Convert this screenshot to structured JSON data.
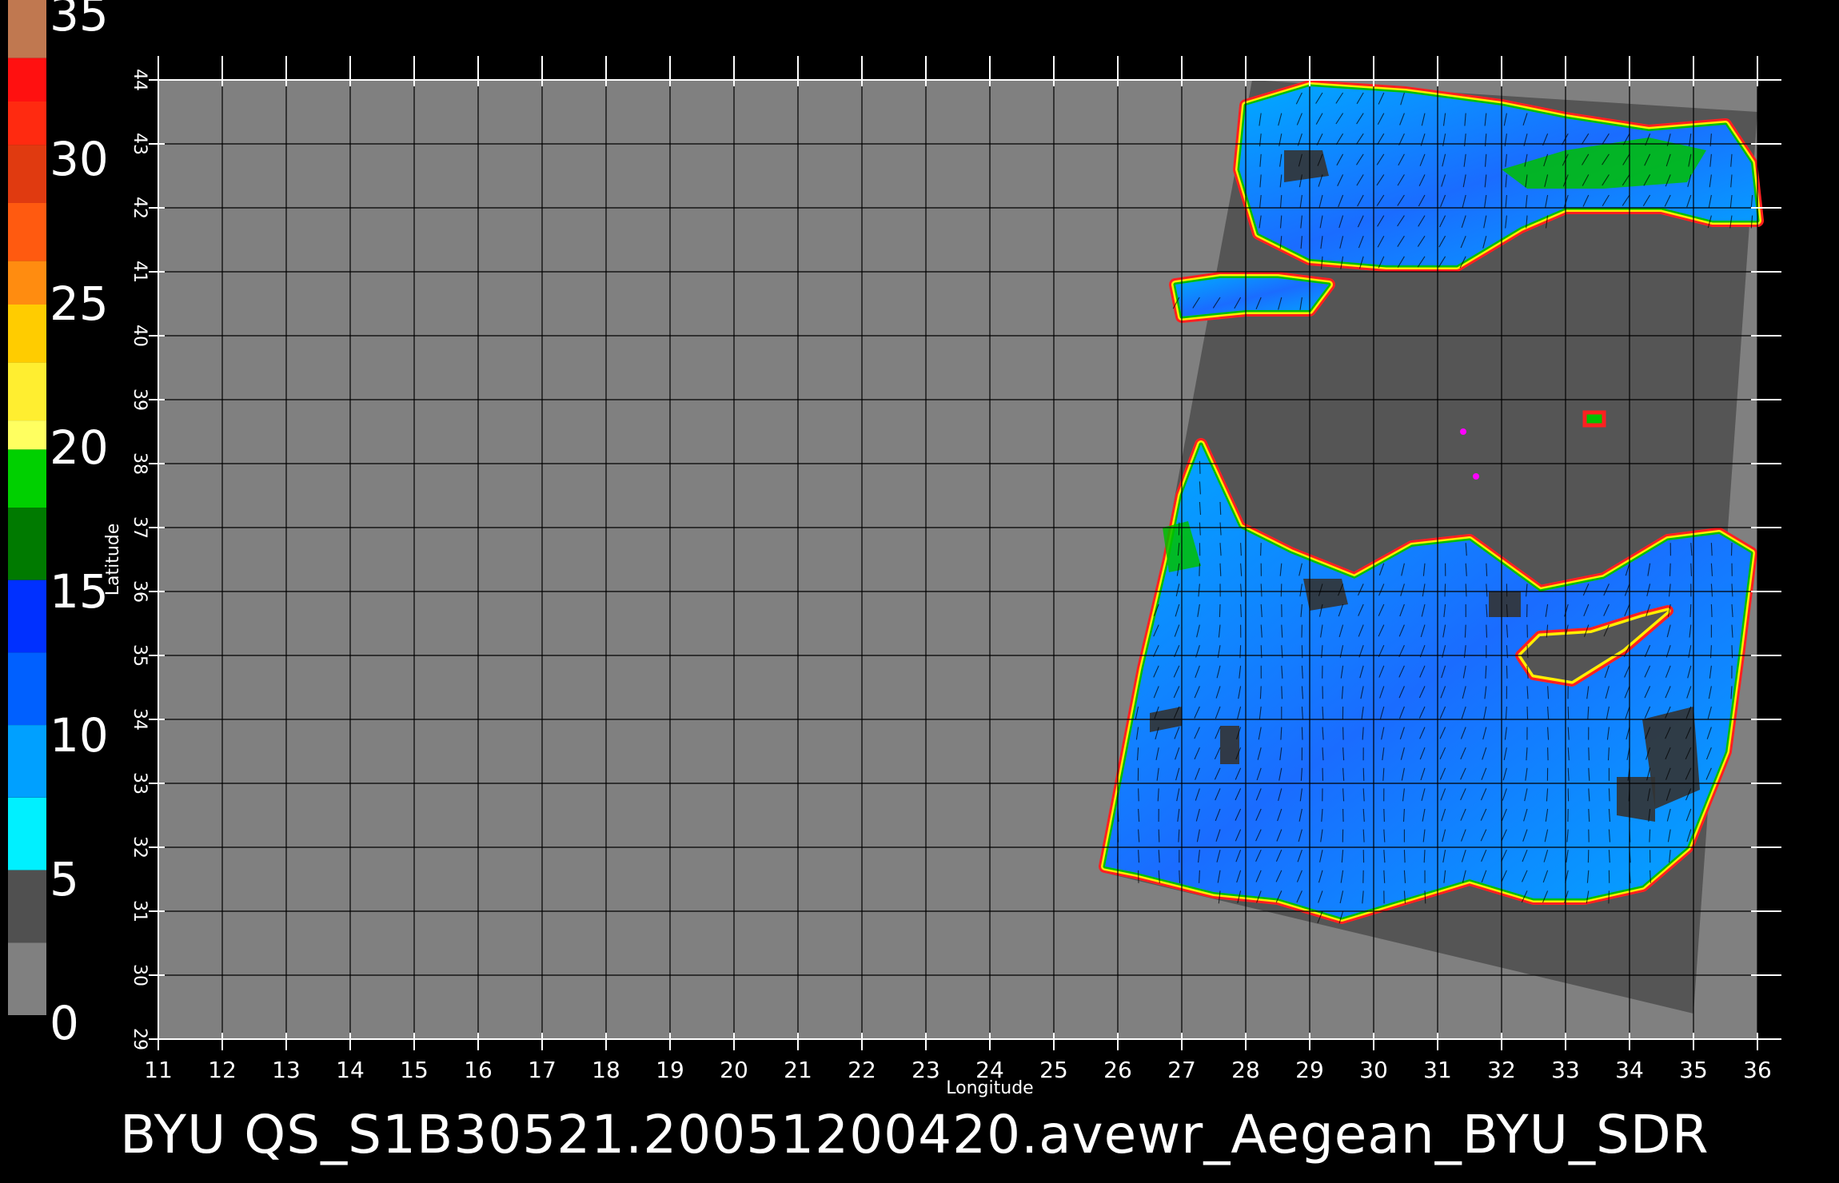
{
  "legend": {
    "tick_labels": [
      "35",
      "30",
      "25",
      "20",
      "15",
      "10",
      "5",
      "0"
    ],
    "color_stops": [
      {
        "from": 35,
        "to": 33,
        "color": "#c07850"
      },
      {
        "from": 33,
        "to": 31.5,
        "color": "#ff1010"
      },
      {
        "from": 31.5,
        "to": 30,
        "color": "#ff2a10"
      },
      {
        "from": 30,
        "to": 28,
        "color": "#e03a10"
      },
      {
        "from": 28,
        "to": 26,
        "color": "#ff5a10"
      },
      {
        "from": 26,
        "to": 24.5,
        "color": "#ff8c10"
      },
      {
        "from": 24.5,
        "to": 22.5,
        "color": "#ffcc00"
      },
      {
        "from": 22.5,
        "to": 20.5,
        "color": "#ffee30"
      },
      {
        "from": 20.5,
        "to": 19.5,
        "color": "#ffff60"
      },
      {
        "from": 19.5,
        "to": 17.5,
        "color": "#00d000"
      },
      {
        "from": 17.5,
        "to": 15,
        "color": "#007a00"
      },
      {
        "from": 15,
        "to": 12.5,
        "color": "#0030ff"
      },
      {
        "from": 12.5,
        "to": 10,
        "color": "#0060ff"
      },
      {
        "from": 10,
        "to": 7.5,
        "color": "#00a0ff"
      },
      {
        "from": 7.5,
        "to": 5,
        "color": "#00f0ff"
      },
      {
        "from": 5,
        "to": 2.5,
        "color": "#505050"
      },
      {
        "from": 2.5,
        "to": 0,
        "color": "#808080"
      }
    ]
  },
  "map": {
    "lon_range": [
      11,
      36
    ],
    "lat_range": [
      29,
      44
    ],
    "x_ticks": [
      "11",
      "12",
      "13",
      "14",
      "15",
      "16",
      "17",
      "18",
      "19",
      "20",
      "21",
      "22",
      "23",
      "24",
      "25",
      "26",
      "27",
      "28",
      "29",
      "30",
      "31",
      "32",
      "33",
      "34",
      "35",
      "36"
    ],
    "y_ticks": [
      "29",
      "30",
      "31",
      "32",
      "33",
      "34",
      "35",
      "36",
      "37",
      "38",
      "39",
      "40",
      "41",
      "42",
      "43",
      "44"
    ],
    "x_axis_label": "Longitude",
    "y_axis_label": "Latitude",
    "colors": {
      "background": "#000000",
      "no_data": "#808080",
      "swath_land": "#555555",
      "grid": "#000000",
      "axis": "#ffffff",
      "wind_low": "#1a6cff",
      "wind_mid": "#00aaff",
      "coast_green": "#00c000",
      "coast_yellow": "#ffee00",
      "coast_red": "#ff2020",
      "coast_magenta": "#ff00ff",
      "land_patch": "#333333"
    },
    "swath_corners": [
      [
        28.1,
        44.0
      ],
      [
        36.0,
        43.5
      ],
      [
        35.0,
        29.4
      ],
      [
        25.8,
        31.6
      ]
    ],
    "sea_regions": {
      "black_sea": [
        [
          28.0,
          43.6
        ],
        [
          29.0,
          43.9
        ],
        [
          30.5,
          43.8
        ],
        [
          32.0,
          43.6
        ],
        [
          33.0,
          43.4
        ],
        [
          34.3,
          43.2
        ],
        [
          35.5,
          43.3
        ],
        [
          35.9,
          42.7
        ],
        [
          36.0,
          41.8
        ],
        [
          35.3,
          41.8
        ],
        [
          34.5,
          42.0
        ],
        [
          33.0,
          42.0
        ],
        [
          32.3,
          41.7
        ],
        [
          31.3,
          41.1
        ],
        [
          30.2,
          41.1
        ],
        [
          29.0,
          41.2
        ],
        [
          28.2,
          41.6
        ],
        [
          27.9,
          42.6
        ]
      ],
      "marmara": [
        [
          26.9,
          40.8
        ],
        [
          27.6,
          40.9
        ],
        [
          28.5,
          40.9
        ],
        [
          29.3,
          40.8
        ],
        [
          29.0,
          40.4
        ],
        [
          28.0,
          40.4
        ],
        [
          27.0,
          40.3
        ]
      ],
      "mediterranean": [
        [
          27.3,
          38.3
        ],
        [
          27.9,
          37.0
        ],
        [
          28.7,
          36.6
        ],
        [
          29.7,
          36.2
        ],
        [
          30.6,
          36.7
        ],
        [
          31.5,
          36.8
        ],
        [
          32.6,
          36.0
        ],
        [
          33.6,
          36.2
        ],
        [
          34.6,
          36.8
        ],
        [
          35.4,
          36.9
        ],
        [
          35.9,
          36.6
        ],
        [
          35.7,
          35.0
        ],
        [
          35.5,
          33.5
        ],
        [
          34.9,
          32.0
        ],
        [
          34.2,
          31.4
        ],
        [
          33.3,
          31.2
        ],
        [
          32.5,
          31.2
        ],
        [
          31.5,
          31.5
        ],
        [
          30.5,
          31.2
        ],
        [
          29.5,
          30.9
        ],
        [
          28.5,
          31.2
        ],
        [
          27.5,
          31.3
        ],
        [
          26.3,
          31.6
        ],
        [
          25.8,
          31.7
        ],
        [
          26.4,
          34.8
        ],
        [
          26.8,
          36.5
        ],
        [
          27.0,
          37.5
        ]
      ]
    },
    "cyprus": [
      [
        32.3,
        35.0
      ],
      [
        32.6,
        35.3
      ],
      [
        33.4,
        35.35
      ],
      [
        34.2,
        35.6
      ],
      [
        34.6,
        35.7
      ],
      [
        33.9,
        35.1
      ],
      [
        33.1,
        34.6
      ],
      [
        32.5,
        34.7
      ]
    ],
    "lakes": [
      [
        33.3,
        38.8
      ],
      [
        33.6,
        38.8
      ],
      [
        33.6,
        38.6
      ],
      [
        33.3,
        38.6
      ]
    ],
    "green_patches": [
      [
        [
          32.0,
          42.6
        ],
        [
          33.0,
          42.9
        ],
        [
          34.3,
          43.1
        ],
        [
          35.2,
          42.9
        ],
        [
          34.9,
          42.4
        ],
        [
          33.6,
          42.3
        ],
        [
          32.4,
          42.3
        ]
      ],
      [
        [
          26.7,
          37.0
        ],
        [
          27.1,
          37.1
        ],
        [
          27.3,
          36.4
        ],
        [
          26.8,
          36.3
        ]
      ]
    ],
    "dark_patches": [
      [
        [
          28.6,
          42.9
        ],
        [
          29.2,
          42.9
        ],
        [
          29.3,
          42.5
        ],
        [
          28.6,
          42.4
        ]
      ],
      [
        [
          28.9,
          36.2
        ],
        [
          29.5,
          36.2
        ],
        [
          29.6,
          35.8
        ],
        [
          29.0,
          35.7
        ]
      ],
      [
        [
          26.5,
          34.1
        ],
        [
          27.0,
          34.2
        ],
        [
          27.0,
          33.9
        ],
        [
          26.5,
          33.8
        ]
      ],
      [
        [
          27.6,
          33.9
        ],
        [
          27.9,
          33.9
        ],
        [
          27.9,
          33.3
        ],
        [
          27.6,
          33.3
        ]
      ],
      [
        [
          31.8,
          36.0
        ],
        [
          32.3,
          36.0
        ],
        [
          32.3,
          35.6
        ],
        [
          31.8,
          35.6
        ]
      ],
      [
        [
          34.2,
          34.0
        ],
        [
          35.0,
          34.2
        ],
        [
          35.1,
          32.9
        ],
        [
          34.4,
          32.6
        ]
      ],
      [
        [
          33.8,
          33.1
        ],
        [
          34.4,
          33.1
        ],
        [
          34.4,
          32.4
        ],
        [
          33.8,
          32.5
        ]
      ]
    ]
  },
  "footer": {
    "title": "BYU  QS_S1B30521.20051200420.avewr_Aegean_BYU_SDR"
  }
}
